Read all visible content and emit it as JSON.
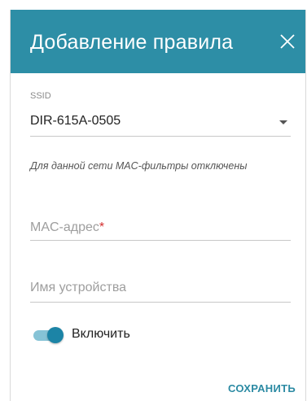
{
  "dialog": {
    "title": "Добавление правила",
    "close_icon": "close-icon",
    "header_color": "#2d8ea6"
  },
  "ssid": {
    "label": "SSID",
    "value": "DIR-615A-0505"
  },
  "notice": "Для данной сети MAC-фильтры отключены",
  "mac_field": {
    "placeholder": "MAC-адрес",
    "required_mark": "*"
  },
  "device_field": {
    "placeholder": "Имя устройства"
  },
  "enable_toggle": {
    "label": "Включить",
    "state": "on"
  },
  "actions": {
    "save_label": "СОХРАНИТЬ"
  }
}
